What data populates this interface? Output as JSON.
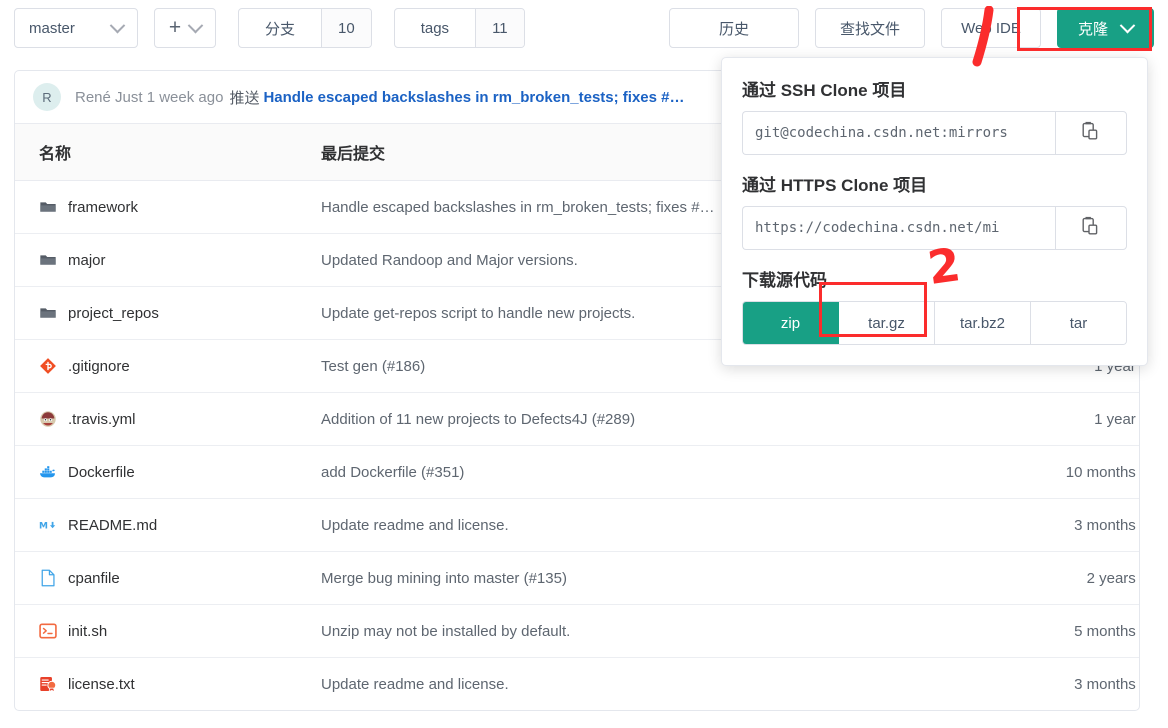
{
  "toolbar": {
    "branch_label": "master",
    "branch_caret_icon": "chevron-down-icon",
    "plus_label": "+",
    "plus_caret_icon": "chevron-down-icon",
    "branches_label": "分支",
    "branches_count": "10",
    "tags_label": "tags",
    "tags_count": "11",
    "history_label": "历史",
    "find_file_label": "查找文件",
    "web_ide_label": "Web IDE",
    "clone_label": "克隆",
    "clone_caret_icon": "chevron-down-icon",
    "clone_button_color": "#18a085"
  },
  "annotations": {
    "accent_color": "#fb2c2c",
    "mark_one": "1",
    "mark_two": "2"
  },
  "commit_bar": {
    "avatar_initial": "R",
    "author": "René Just",
    "time": "1 week ago",
    "action": "推送",
    "message": "Handle escaped backslashes in rm_broken_tests; fixes #…"
  },
  "file_table": {
    "headers": {
      "name": "名称",
      "message": "最后提交",
      "time": ""
    },
    "rows": [
      {
        "icon": "folder-icon",
        "name": "framework",
        "message": "Handle escaped backslashes in rm_broken_tests; fixes #…",
        "time": ""
      },
      {
        "icon": "folder-icon",
        "name": "major",
        "message": "Updated Randoop and Major versions.",
        "time": ""
      },
      {
        "icon": "folder-icon",
        "name": "project_repos",
        "message": "Update get-repos script to handle new projects.",
        "time": ""
      },
      {
        "icon": "gitignore-icon",
        "name": ".gitignore",
        "message": "Test gen (#186)",
        "time": "1 year ago"
      },
      {
        "icon": "travis-icon",
        "name": ".travis.yml",
        "message": "Addition of 11 new projects to Defects4J (#289)",
        "time": "1 year ago"
      },
      {
        "icon": "docker-icon",
        "name": "Dockerfile",
        "message": "add Dockerfile (#351)",
        "time": "10 months ago"
      },
      {
        "icon": "markdown-icon",
        "name": "README.md",
        "message": "Update readme and license.",
        "time": "3 months ago"
      },
      {
        "icon": "file-icon",
        "name": "cpanfile",
        "message": "Merge bug mining into master (#135)",
        "time": "2 years ago"
      },
      {
        "icon": "shell-icon",
        "name": "init.sh",
        "message": "Unzip may not be installed by default.",
        "time": "5 months ago"
      },
      {
        "icon": "license-icon",
        "name": "license.txt",
        "message": "Update readme and license.",
        "time": "3 months ago"
      }
    ]
  },
  "clone_panel": {
    "ssh_title": "通过 SSH Clone 项目",
    "ssh_url": "git@codechina.csdn.net:mirrors",
    "ssh_copy_icon": "clipboard-icon",
    "https_title": "通过 HTTPS Clone 项目",
    "https_url": "https://codechina.csdn.net/mi",
    "https_copy_icon": "clipboard-icon",
    "download_title": "下载源代码",
    "formats": [
      {
        "label": "zip",
        "active": true
      },
      {
        "label": "tar.gz",
        "active": false
      },
      {
        "label": "tar.bz2",
        "active": false
      },
      {
        "label": "tar",
        "active": false
      }
    ]
  }
}
